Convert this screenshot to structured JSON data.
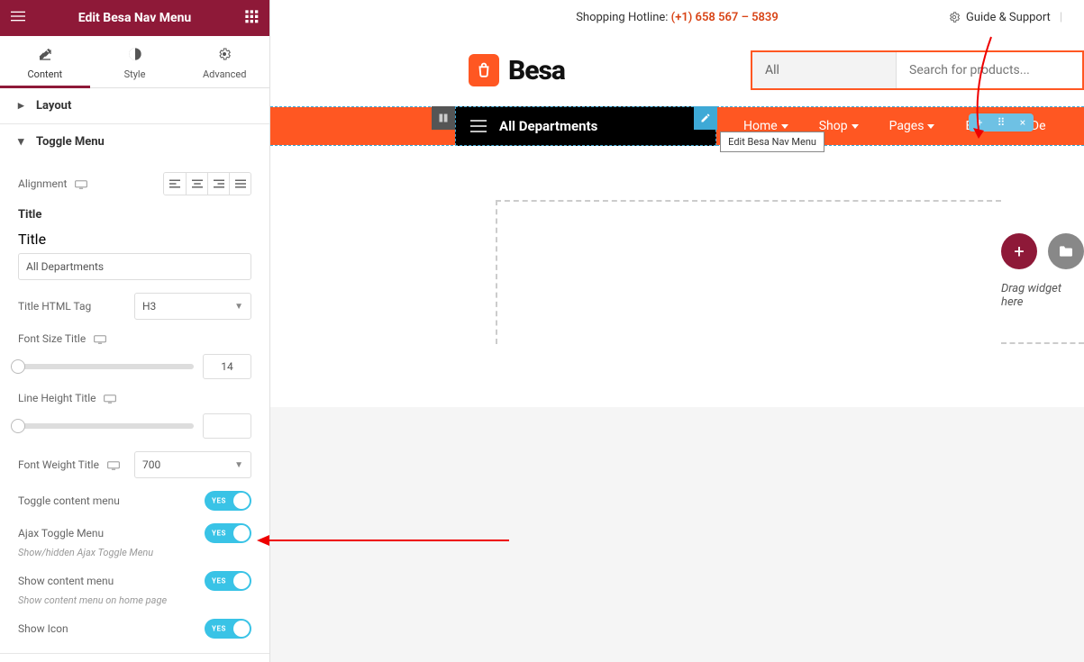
{
  "panel": {
    "header_title": "Edit Besa Nav Menu",
    "tabs": {
      "content": "Content",
      "style": "Style",
      "advanced": "Advanced"
    },
    "sections": {
      "layout": "Layout",
      "toggle_menu": "Toggle Menu"
    },
    "fields": {
      "alignment_label": "Alignment",
      "title_heading": "Title",
      "title_label": "Title",
      "title_value": "All Departments",
      "title_html_tag_label": "Title HTML Tag",
      "title_html_tag_value": "H3",
      "font_size_title_label": "Font Size Title",
      "font_size_title_value": "14",
      "line_height_title_label": "Line Height Title",
      "line_height_title_value": "",
      "font_weight_title_label": "Font Weight Title",
      "font_weight_title_value": "700",
      "toggle_content_menu_label": "Toggle content menu",
      "ajax_toggle_label": "Ajax Toggle Menu",
      "ajax_toggle_hint": "Show/hidden Ajax Toggle Menu",
      "show_content_menu_label": "Show content menu",
      "show_content_menu_hint": "Show content menu on home page",
      "show_icon_label": "Show Icon",
      "toggle_yes": "YES"
    }
  },
  "preview": {
    "hotline_label": "Shopping Hotline: ",
    "hotline_number": "(+1) 658 567 – 5839",
    "guide_support": "Guide & Support",
    "logo_text": "Besa",
    "search_category": "All",
    "search_placeholder": "Search for products...",
    "all_departments": "All Departments",
    "edit_tooltip": "Edit Besa Nav Menu",
    "nav": {
      "home": "Home",
      "shop": "Shop",
      "pages": "Pages",
      "electronics": "Electronics De"
    },
    "drag_hint": "Drag widget here"
  }
}
